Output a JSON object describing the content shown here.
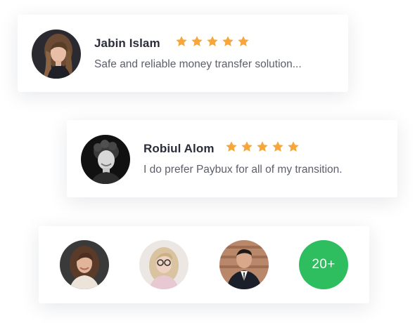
{
  "reviews": [
    {
      "name": "Jabin Islam",
      "rating": 5,
      "text": "Safe and reliable money transfer solution..."
    },
    {
      "name": "Robiul Alom",
      "rating": 5,
      "text": "I do prefer Paybux for all of my transition."
    }
  ],
  "users": {
    "more_count": "20+"
  },
  "colors": {
    "star": "#f6a63a",
    "badge": "#2ebd5f",
    "name_text": "#2b2e3a",
    "body_text": "#5c5f6b"
  },
  "icons": {
    "star": "star-icon"
  }
}
